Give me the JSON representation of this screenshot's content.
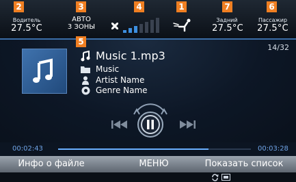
{
  "callouts": {
    "driver": "2",
    "auto": "3",
    "fan": "4",
    "vent": "1",
    "rear": "7",
    "passenger": "6",
    "track": "5"
  },
  "climate": {
    "driver_label": "Водитель",
    "driver_temp": "27.5°C",
    "mode_line1": "АВТО",
    "mode_line2": "3 ЗОНЫ",
    "rear_label": "Задний",
    "rear_temp": "27.5°C",
    "passenger_label": "Пассажир",
    "passenger_temp": "27.5°C",
    "fan_level_fraction": 0.43
  },
  "track": {
    "title": "Music 1.mp3",
    "folder": "Music",
    "artist": "Artist Name",
    "genre": "Genre Name",
    "counter": "14/32"
  },
  "playback": {
    "elapsed": "00:02:43",
    "total": "00:03:28",
    "progress_fraction": 0.78
  },
  "menu": {
    "file_info": "Инфо о файле",
    "menu": "МЕНЮ",
    "show_list": "Показать список"
  },
  "colors": {
    "accent": "#f07f22",
    "progress": "#6ab0ff",
    "fan_active": "#3d8fe0"
  },
  "icons": [
    "fan-icon",
    "vent-icon",
    "album-note-icon",
    "music-note-icon",
    "folder-icon",
    "artist-icon",
    "genre-icon",
    "previous-icon",
    "pause-icon",
    "next-icon",
    "repeat-icon",
    "sd-card-icon"
  ]
}
